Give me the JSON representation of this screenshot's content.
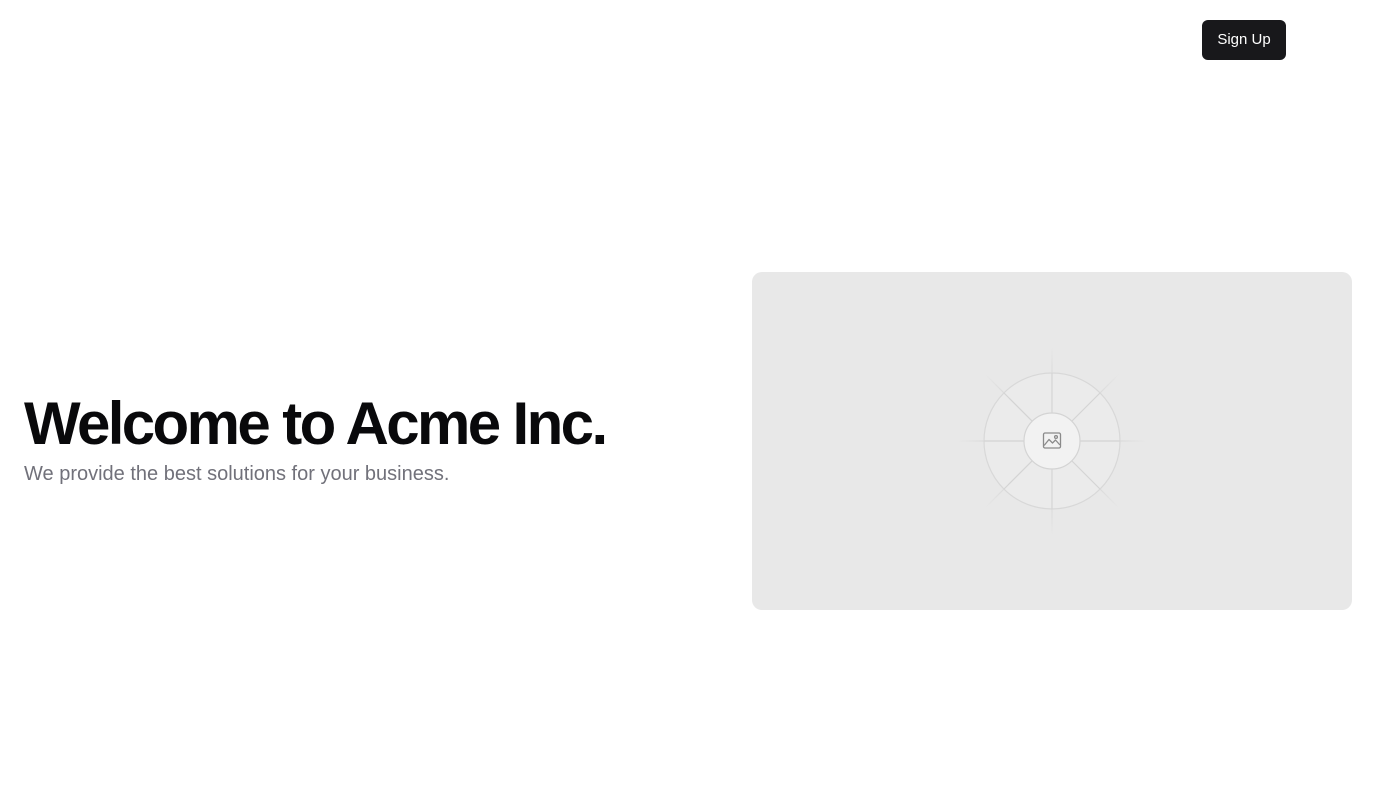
{
  "header": {
    "signup_label": "Sign Up"
  },
  "hero": {
    "title": "Welcome to Acme Inc.",
    "subtitle": "We provide the best solutions for your business."
  },
  "placeholder": {
    "icon": "image-icon"
  },
  "colors": {
    "button_bg": "#18181b",
    "title": "#09090b",
    "subtitle": "#71717a",
    "placeholder_bg": "#e8e8e8"
  }
}
